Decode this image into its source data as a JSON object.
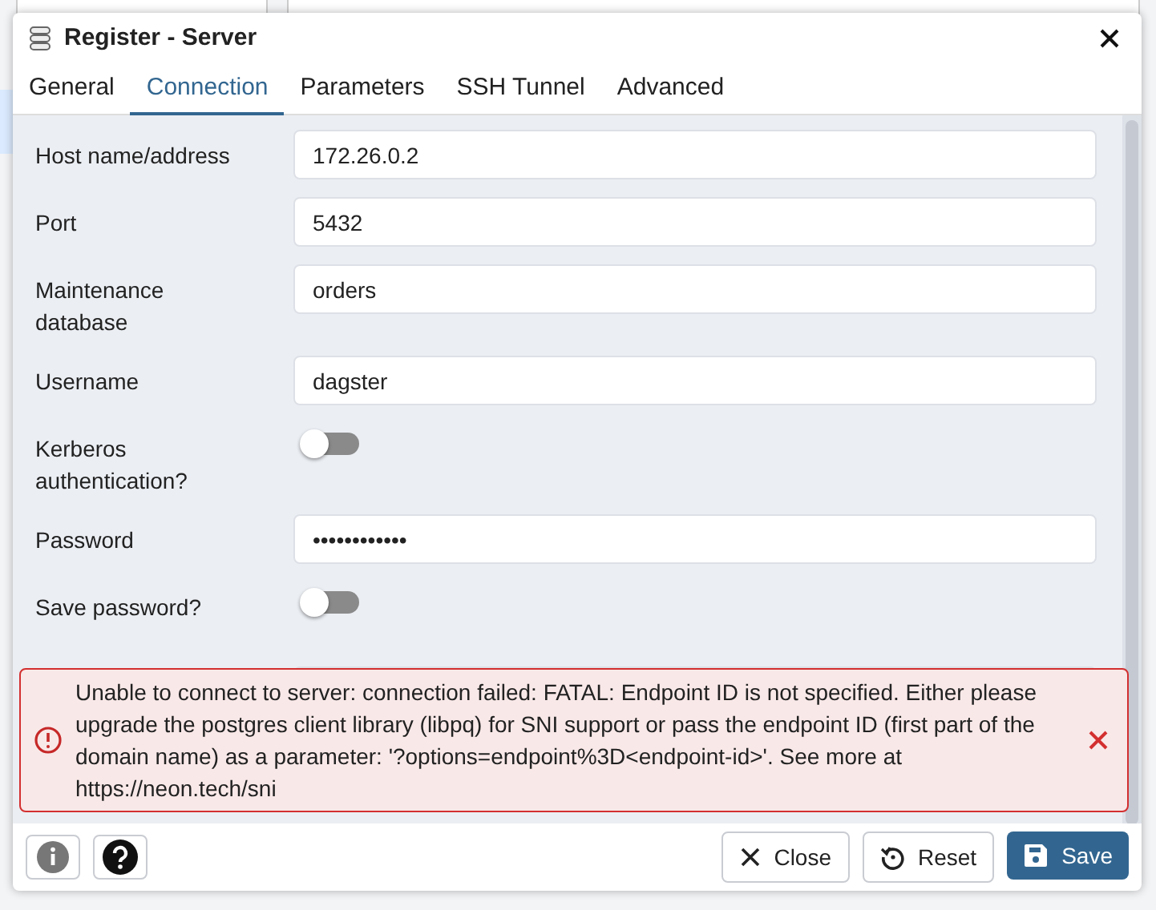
{
  "dialog": {
    "title": "Register - Server"
  },
  "tabs": [
    {
      "label": "General",
      "selected": false
    },
    {
      "label": "Connection",
      "selected": true
    },
    {
      "label": "Parameters",
      "selected": false
    },
    {
      "label": "SSH Tunnel",
      "selected": false
    },
    {
      "label": "Advanced",
      "selected": false
    }
  ],
  "fields": [
    {
      "kind": "text",
      "label": "Host name/address",
      "value": "172.26.0.2"
    },
    {
      "kind": "text",
      "label": "Port",
      "value": "5432"
    },
    {
      "kind": "text",
      "label": "Maintenance database",
      "value": "orders"
    },
    {
      "kind": "text",
      "label": "Username",
      "value": "dagster"
    },
    {
      "kind": "toggle",
      "label": "Kerberos authentication?",
      "on": false
    },
    {
      "kind": "text",
      "label": "Password",
      "value": "••••••••••••"
    },
    {
      "kind": "toggle",
      "label": "Save password?",
      "on": false
    },
    {
      "kind": "covered"
    }
  ],
  "error": {
    "message": "Unable to connect to server: connection failed: FATAL: Endpoint ID is not specified. Either please upgrade the postgres client library (libpq) for SNI support or pass the endpoint ID (first part of the domain name) as a parameter: '?options=endpoint%3D<endpoint-id>'. See more at https://neon.tech/sni"
  },
  "footer_tools": [
    {
      "kind": "info"
    },
    {
      "kind": "help"
    }
  ],
  "actions": [
    {
      "kind": "close",
      "label": "Close"
    },
    {
      "kind": "reset",
      "label": "Reset"
    },
    {
      "kind": "save",
      "label": "Save"
    }
  ]
}
